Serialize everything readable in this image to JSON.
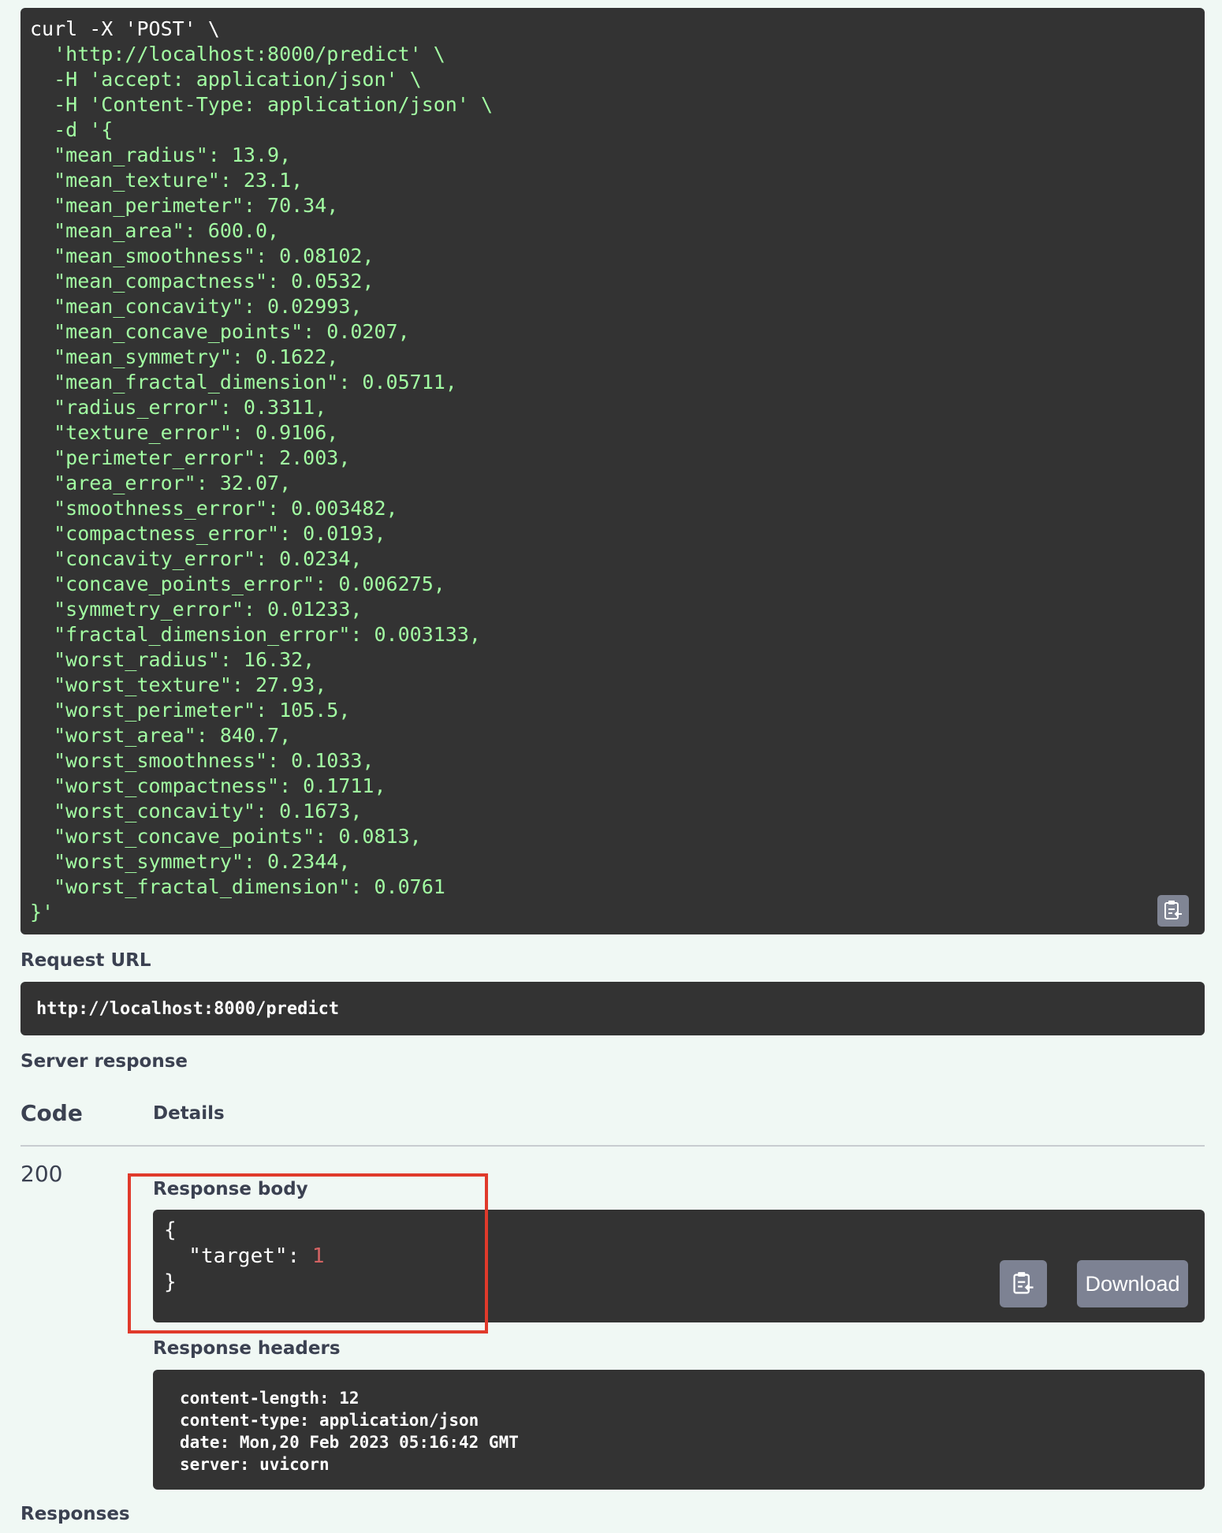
{
  "curl": {
    "command_lines": [
      "curl -X 'POST' \\",
      "  'http://localhost:8000/predict' \\",
      "  -H 'accept: application/json' \\",
      "  -H 'Content-Type: application/json' \\",
      "  -d '{"
    ],
    "body_lines": [
      "  \"mean_radius\": 13.9,",
      "  \"mean_texture\": 23.1,",
      "  \"mean_perimeter\": 70.34,",
      "  \"mean_area\": 600.0,",
      "  \"mean_smoothness\": 0.08102,",
      "  \"mean_compactness\": 0.0532,",
      "  \"mean_concavity\": 0.02993,",
      "  \"mean_concave_points\": 0.0207,",
      "  \"mean_symmetry\": 0.1622,",
      "  \"mean_fractal_dimension\": 0.05711,",
      "  \"radius_error\": 0.3311,",
      "  \"texture_error\": 0.9106,",
      "  \"perimeter_error\": 2.003,",
      "  \"area_error\": 32.07,",
      "  \"smoothness_error\": 0.003482,",
      "  \"compactness_error\": 0.0193,",
      "  \"concavity_error\": 0.0234,",
      "  \"concave_points_error\": 0.006275,",
      "  \"symmetry_error\": 0.01233,",
      "  \"fractal_dimension_error\": 0.003133,",
      "  \"worst_radius\": 16.32,",
      "  \"worst_texture\": 27.93,",
      "  \"worst_perimeter\": 105.5,",
      "  \"worst_area\": 840.7,",
      "  \"worst_smoothness\": 0.1033,",
      "  \"worst_compactness\": 0.1711,",
      "  \"worst_concavity\": 0.1673,",
      "  \"worst_concave_points\": 0.0813,",
      "  \"worst_symmetry\": 0.2344,",
      "  \"worst_fractal_dimension\": 0.0761",
      "}'"
    ],
    "copy_icon": "clipboard-icon"
  },
  "request_url": {
    "label": "Request URL",
    "value": "http://localhost:8000/predict"
  },
  "server_response": {
    "label": "Server response",
    "code_header": "Code",
    "details_header": "Details",
    "code": "200",
    "response_body": {
      "label": "Response body",
      "open": "{",
      "key": "  \"target\": ",
      "value": "1",
      "close": "}",
      "download_label": "Download",
      "copy_icon": "clipboard-icon"
    },
    "response_headers": {
      "label": "Response headers",
      "lines": [
        "content-length: 12",
        "content-type: application/json",
        "date: Mon,20 Feb 2023 05:16:42 GMT",
        "server: uvicorn"
      ]
    }
  },
  "responses_label": "Responses",
  "colors": {
    "background": "#f0f8f4",
    "code_bg": "#333333",
    "code_green": "#a2fca2",
    "number_red": "#d36363",
    "highlight_red": "#e03a2b",
    "button_gray": "#7d8293"
  }
}
